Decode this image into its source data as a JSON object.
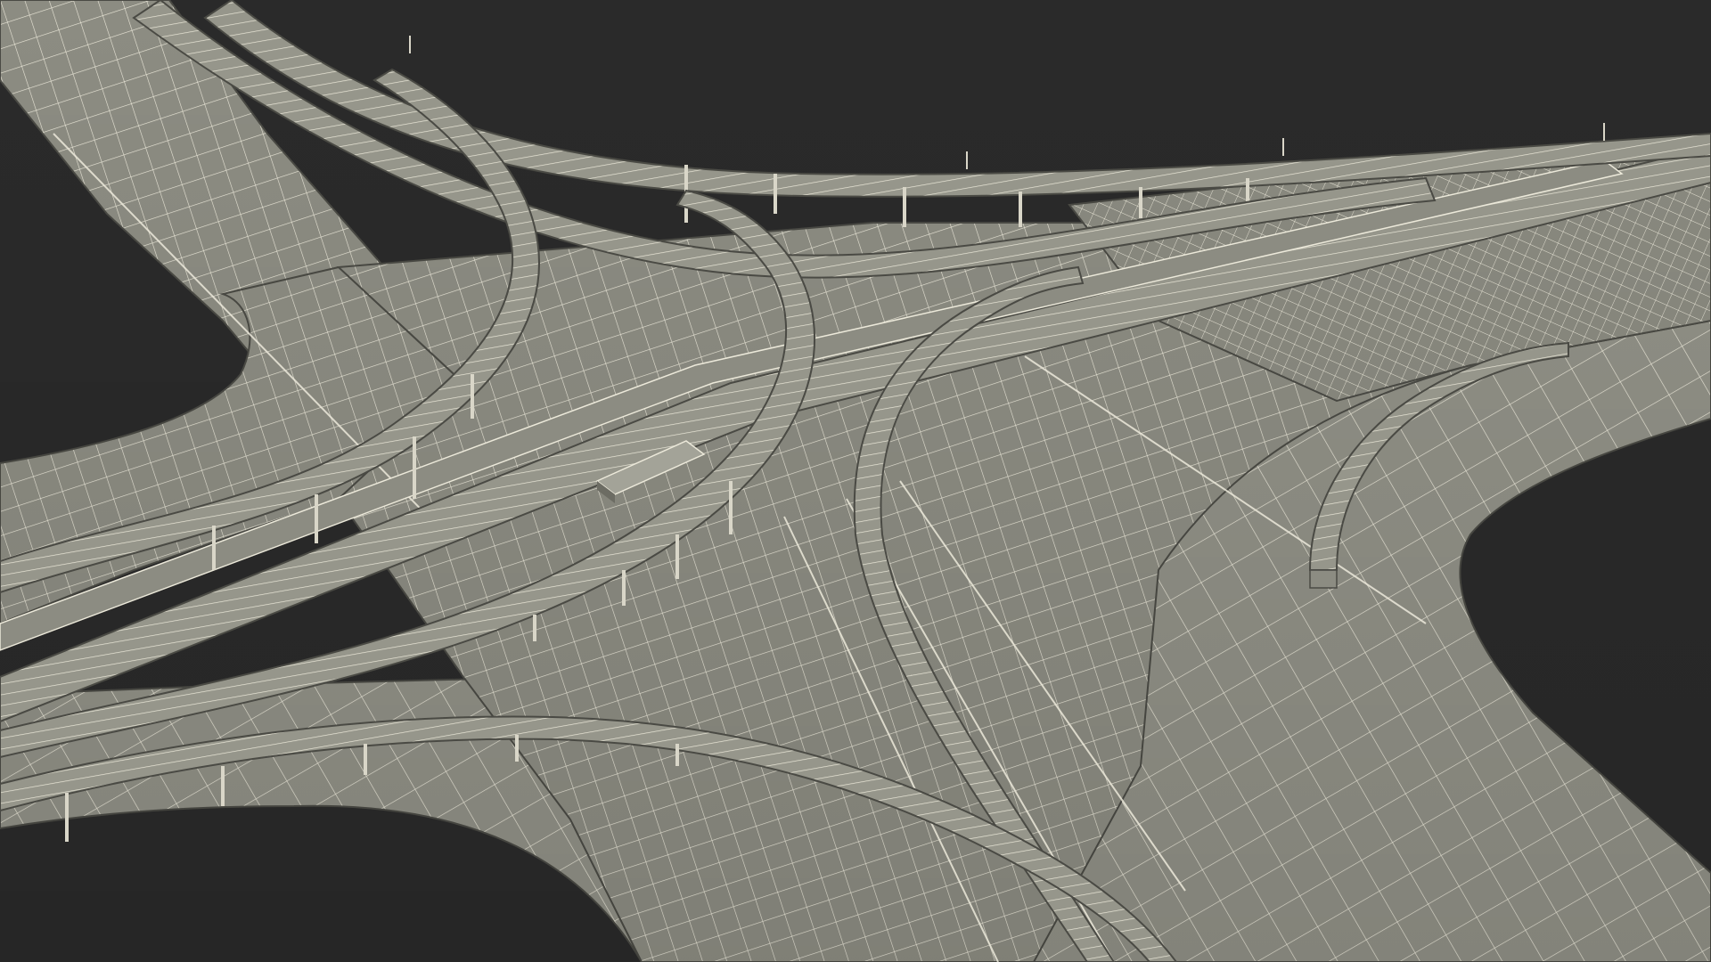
{
  "scene": {
    "subject": "interchange-wireframe-render",
    "colors": {
      "background": "#2a2a2a",
      "surface": "#8c8c82",
      "surface_shadow": "#6c6c63",
      "surface_light": "#a3a398",
      "wire": "#ece9da",
      "edge": "#4a4a44"
    },
    "ramps": [
      {
        "id": "ramp-top-arc"
      },
      {
        "id": "ramp-left-loop"
      },
      {
        "id": "ramp-center-loop"
      },
      {
        "id": "ramp-right-loop"
      },
      {
        "id": "ramp-far-right-loop"
      },
      {
        "id": "ramp-bottom-arc"
      },
      {
        "id": "ramp-diagonal-mainline"
      }
    ]
  }
}
